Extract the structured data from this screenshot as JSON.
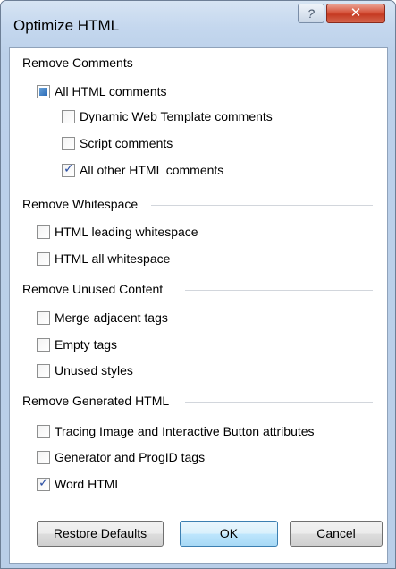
{
  "window": {
    "title": "Optimize HTML",
    "help_label": "?",
    "close_label": "✕"
  },
  "sections": {
    "comments": {
      "heading": "Remove Comments",
      "all": {
        "label": "All HTML comments",
        "state": "partial"
      },
      "dwt": {
        "label": "Dynamic Web Template comments",
        "checked": false
      },
      "script": {
        "label": "Script comments",
        "checked": false
      },
      "other": {
        "label": "All other HTML comments",
        "checked": true
      }
    },
    "whitespace": {
      "heading": "Remove Whitespace",
      "leading": {
        "label": "HTML leading whitespace",
        "checked": false
      },
      "all": {
        "label": "HTML all whitespace",
        "checked": false
      }
    },
    "unused": {
      "heading": "Remove Unused Content",
      "merge": {
        "label": "Merge adjacent tags",
        "checked": false
      },
      "empty": {
        "label": "Empty tags",
        "checked": false
      },
      "styles": {
        "label": "Unused styles",
        "checked": false
      }
    },
    "generated": {
      "heading": "Remove Generated HTML",
      "tracing": {
        "label": "Tracing Image and Interactive Button attributes",
        "checked": false
      },
      "generator": {
        "label": "Generator and ProgID tags",
        "checked": false
      },
      "word": {
        "label": "Word HTML",
        "checked": true
      }
    }
  },
  "buttons": {
    "restore": "Restore Defaults",
    "ok": "OK",
    "cancel": "Cancel"
  }
}
